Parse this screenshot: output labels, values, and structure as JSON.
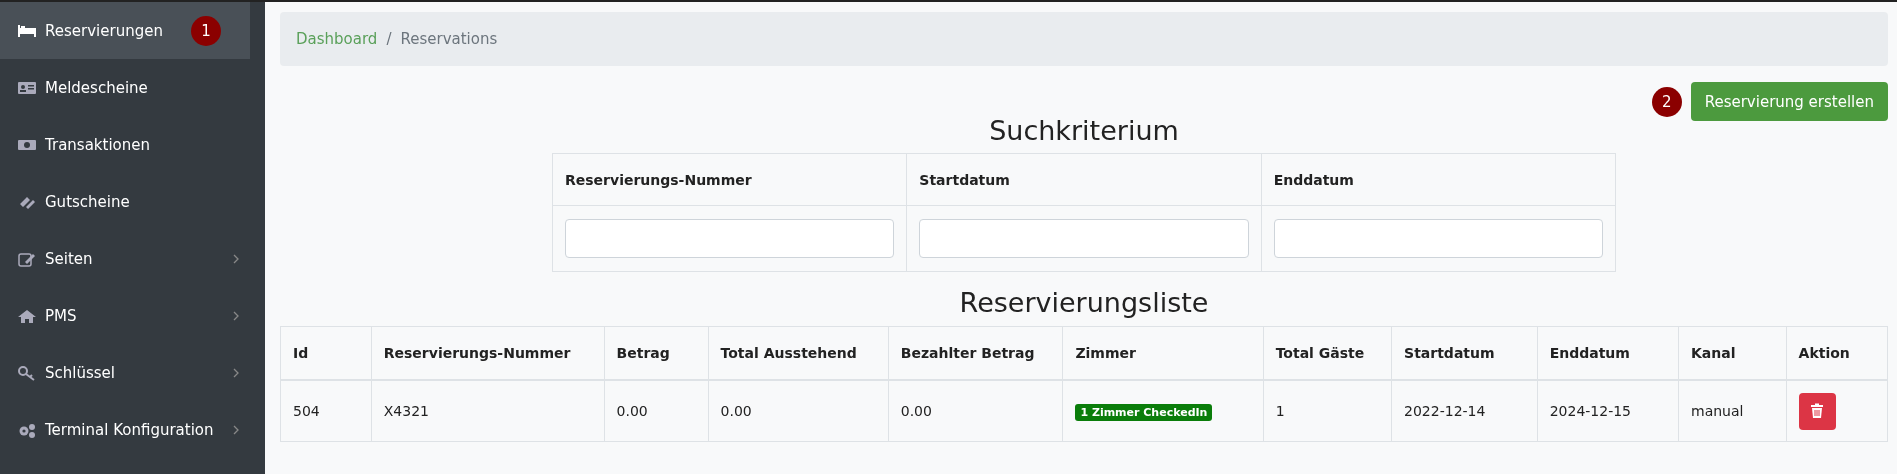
{
  "sidebar": {
    "items": [
      {
        "label": "Reservierungen",
        "selected": true,
        "has_submenu": false,
        "callout": "1"
      },
      {
        "label": "Meldescheine",
        "selected": false,
        "has_submenu": false
      },
      {
        "label": "Transaktionen",
        "selected": false,
        "has_submenu": false
      },
      {
        "label": "Gutscheine",
        "selected": false,
        "has_submenu": false
      },
      {
        "label": "Seiten",
        "selected": false,
        "has_submenu": true
      },
      {
        "label": "PMS",
        "selected": false,
        "has_submenu": true
      },
      {
        "label": "Schlüssel",
        "selected": false,
        "has_submenu": true
      },
      {
        "label": "Terminal Konfiguration",
        "selected": false,
        "has_submenu": true
      }
    ]
  },
  "breadcrumb": [
    {
      "label": "Dashboard",
      "link": true
    },
    {
      "label": "Reservations",
      "link": false
    }
  ],
  "breadcrumb_separator": "/",
  "create_button": {
    "label": "Reservierung erstellen",
    "callout": "2"
  },
  "search": {
    "title": "Suchkriterium",
    "columns": [
      "Reservierungs-Nummer",
      "Startdatum",
      "Enddatum"
    ]
  },
  "table": {
    "title": "Reservierungsliste",
    "columns": [
      "Id",
      "Reservierungs-Nummer",
      "Betrag",
      "Total Ausstehend",
      "Bezahlter Betrag",
      "Zimmer",
      "Total Gäste",
      "Startdatum",
      "Enddatum",
      "Kanal",
      "Aktion"
    ],
    "rows": [
      {
        "id": "504",
        "number": "X4321",
        "amount": "0.00",
        "outstanding": "0.00",
        "paid": "0.00",
        "rooms": "1 Zimmer CheckedIn",
        "guests": "1",
        "start": "2022-12-14",
        "end": "2024-12-15",
        "channel": "manual"
      }
    ]
  }
}
